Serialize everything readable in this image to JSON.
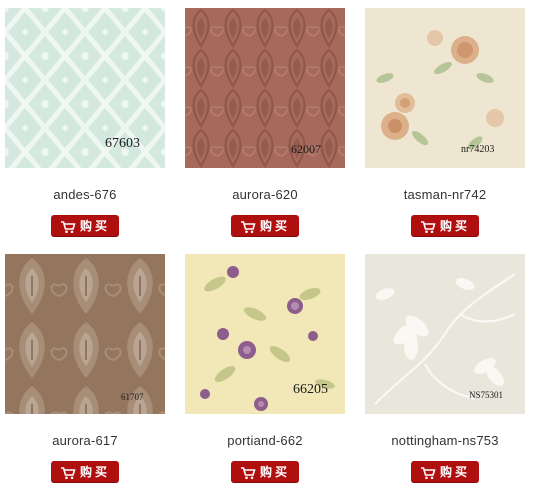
{
  "products": [
    {
      "name": "andes-676",
      "code": "67603",
      "buy_label": "购买",
      "colors": {
        "base": "#d3e8df",
        "pattern": "#eef7f2"
      }
    },
    {
      "name": "aurora-620",
      "code": "62007",
      "buy_label": "购买",
      "colors": {
        "base": "#a66a5c",
        "pattern": "#8e5648"
      }
    },
    {
      "name": "tasman-nr742",
      "code": "nr74203",
      "buy_label": "购买",
      "colors": {
        "base": "#efe6d2",
        "pattern": "#d9a77e"
      }
    },
    {
      "name": "aurora-617",
      "code": "61707",
      "buy_label": "购买",
      "colors": {
        "base": "#94765f",
        "pattern": "#b8a594"
      }
    },
    {
      "name": "portiand-662",
      "code": "66205",
      "buy_label": "购买",
      "colors": {
        "base": "#f1e7b7",
        "pattern": "#8d5d8c"
      }
    },
    {
      "name": "nottingham-ns753",
      "code": "NS75301",
      "buy_label": "购买",
      "colors": {
        "base": "#e9e6dc",
        "pattern": "#fbfaf5"
      }
    }
  ],
  "accent_color": "#b00f10",
  "icons": {
    "buy": "shopping-cart-icon"
  }
}
